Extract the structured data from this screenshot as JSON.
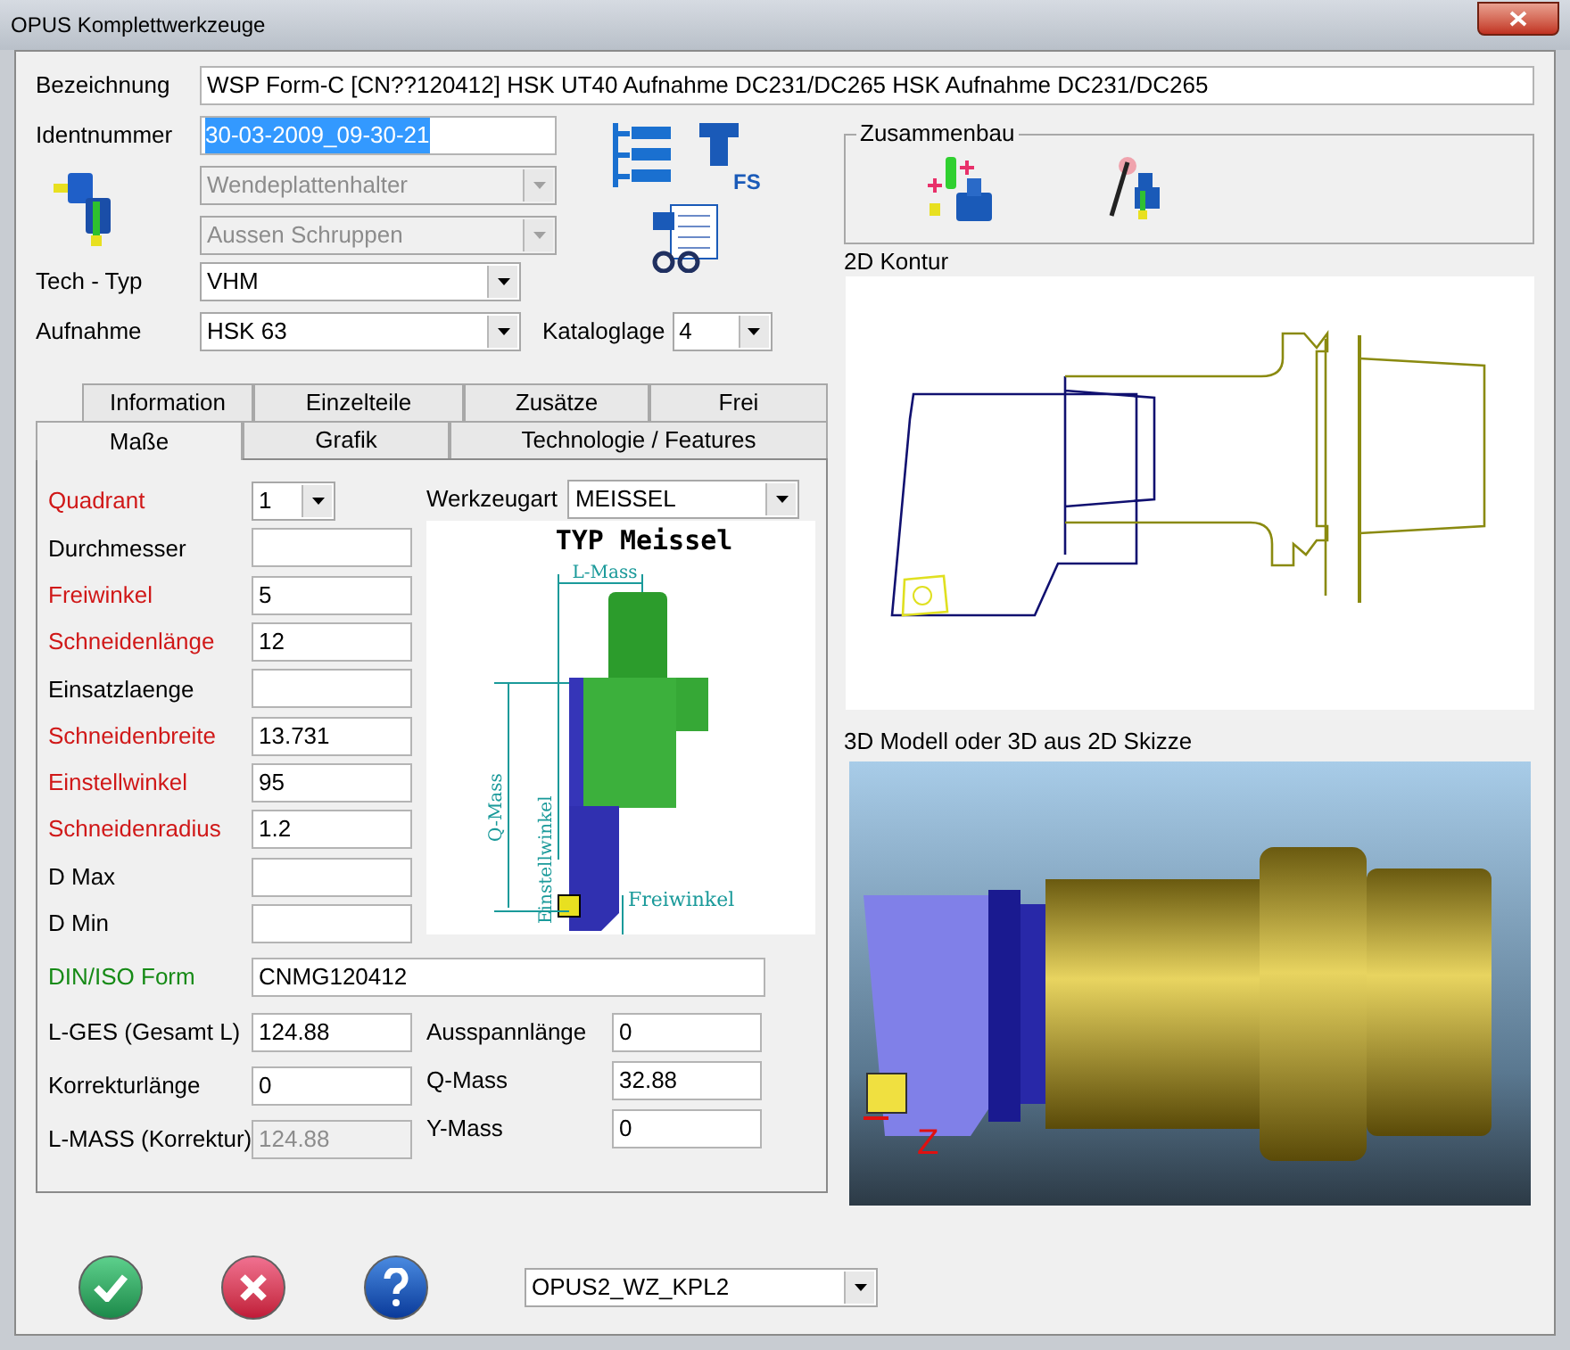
{
  "window": {
    "title": "OPUS Komplettwerkzeuge"
  },
  "header": {
    "bezeichnung": {
      "label": "Bezeichnung",
      "value": "WSP Form-C [CN??120412] HSK UT40 Aufnahme DC231/DC265 HSK Aufnahme DC231/DC265"
    },
    "identnummer": {
      "label": "Identnummer",
      "value": "30-03-2009_09-30-21",
      "selected": true
    },
    "category_combos": [
      {
        "value": "Wendeplattenhalter",
        "disabled": true
      },
      {
        "value": "Aussen Schruppen",
        "disabled": true
      }
    ],
    "tech_typ": {
      "label": "Tech - Typ",
      "value": "VHM"
    },
    "aufnahme": {
      "label": "Aufnahme",
      "value": "HSK 63"
    },
    "kataloglage": {
      "label": "Kataloglage",
      "value": "4"
    },
    "tool_icon_caption": "FS"
  },
  "tabs": [
    [
      {
        "label": "Information",
        "selected": false
      },
      {
        "label": "Einzelteile",
        "selected": false
      },
      {
        "label": "Zusätze",
        "selected": false
      },
      {
        "label": "Frei",
        "selected": false
      }
    ],
    [
      {
        "label": "Maße",
        "selected": true
      },
      {
        "label": "Grafik",
        "selected": false
      },
      {
        "label": "Technologie / Features",
        "selected": false
      }
    ]
  ],
  "dimensions": {
    "werkzeugart": {
      "label": "Werkzeugart",
      "value": "MEISSEL"
    },
    "diagram": {
      "title": "TYP Meissel",
      "l_mass": "L-Mass",
      "q_mass": "Q-Mass",
      "einstellwinkel": "Einstellwinkel",
      "freiwinkel": "Freiwinkel"
    },
    "rows": [
      {
        "label": "Quadrant",
        "value": "1",
        "kind": "combo",
        "color": "#d01818"
      },
      {
        "label": "Durchmesser",
        "value": "",
        "kind": "field",
        "color": "#000000"
      },
      {
        "label": "Freiwinkel",
        "value": "5",
        "kind": "field",
        "color": "#d01818"
      },
      {
        "label": "Schneidenlänge",
        "value": "12",
        "kind": "field",
        "color": "#d01818"
      },
      {
        "label": "Einsatzlaenge",
        "value": "",
        "kind": "field",
        "color": "#000000"
      },
      {
        "label": "Schneidenbreite",
        "value": "13.731",
        "kind": "field",
        "color": "#d01818"
      },
      {
        "label": "Einstellwinkel",
        "value": "95",
        "kind": "field",
        "color": "#d01818"
      },
      {
        "label": "Schneidenradius",
        "value": "1.2",
        "kind": "field",
        "color": "#d01818"
      },
      {
        "label": "D Max",
        "value": "",
        "kind": "field",
        "color": "#000000"
      },
      {
        "label": "D Min",
        "value": "",
        "kind": "field",
        "color": "#000000"
      }
    ],
    "din_iso": {
      "label": "DIN/ISO Form",
      "value": "CNMG120412",
      "color": "#168a16"
    },
    "lower_left": [
      {
        "label": "L-GES (Gesamt L)",
        "value": "124.88",
        "disabled": false
      },
      {
        "label": "Korrekturlänge",
        "value": "0",
        "disabled": false
      },
      {
        "label": "L-MASS (Korrektur)",
        "value": "124.88",
        "disabled": true
      }
    ],
    "lower_right": [
      {
        "label": "Ausspannlänge",
        "value": "0"
      },
      {
        "label": "Q-Mass",
        "value": "32.88"
      },
      {
        "label": "Y-Mass",
        "value": "0"
      }
    ]
  },
  "assembly": {
    "title": "Zusammenbau"
  },
  "contour_2d": {
    "title": "2D Kontur"
  },
  "model_3d": {
    "title": "3D Modell oder 3D aus 2D Skizze",
    "axis_label": "Z"
  },
  "footer": {
    "config": {
      "value": "OPUS2_WZ_KPL2"
    }
  }
}
